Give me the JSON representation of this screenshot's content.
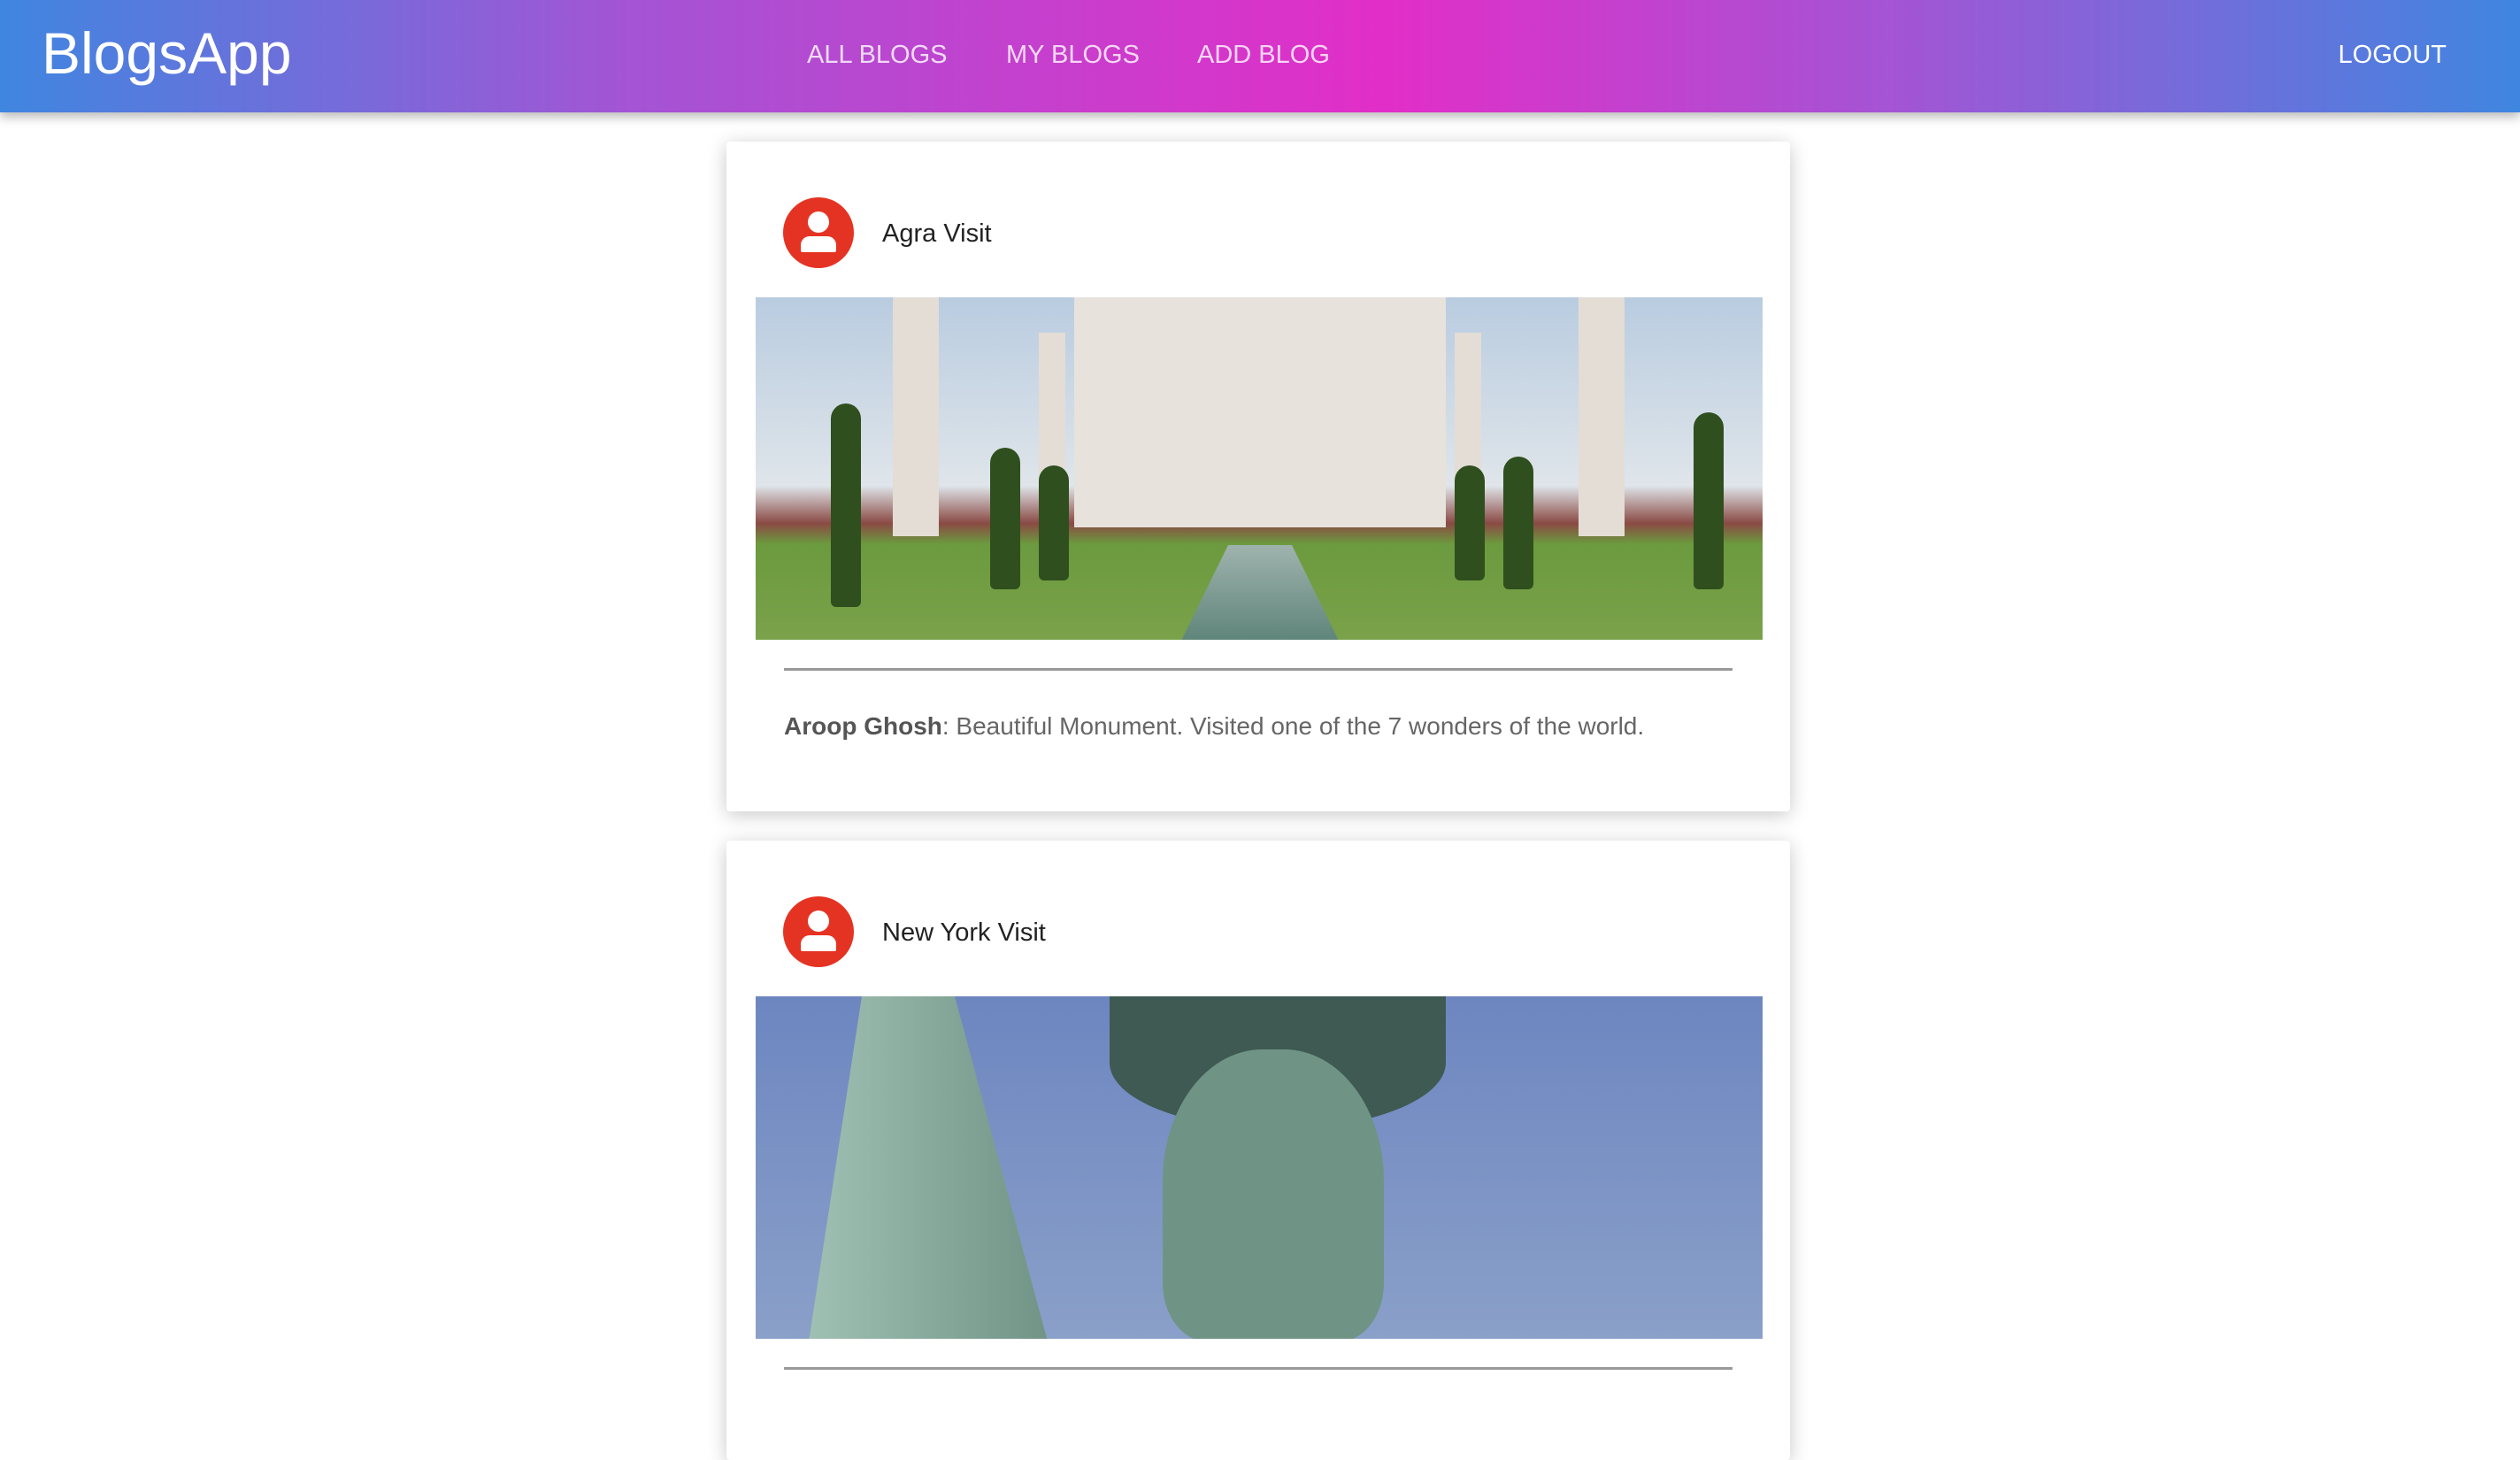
{
  "header": {
    "logo": "BlogsApp",
    "nav": [
      "ALL BLOGS",
      "MY BLOGS",
      "ADD BLOG"
    ],
    "logout": "LOGOUT",
    "gradient_colors": [
      "#3f86e0",
      "#e22ec8"
    ]
  },
  "posts": [
    {
      "title": "Agra Visit",
      "author": "Aroop Ghosh",
      "separator": ":",
      "body": " Beautiful Monument. Visited one of the 7 wonders of the world.",
      "image": "taj-mahal-photo"
    },
    {
      "title": "New York Visit",
      "image": "statue-of-liberty-photo"
    }
  ],
  "avatar_color": "#e53323"
}
